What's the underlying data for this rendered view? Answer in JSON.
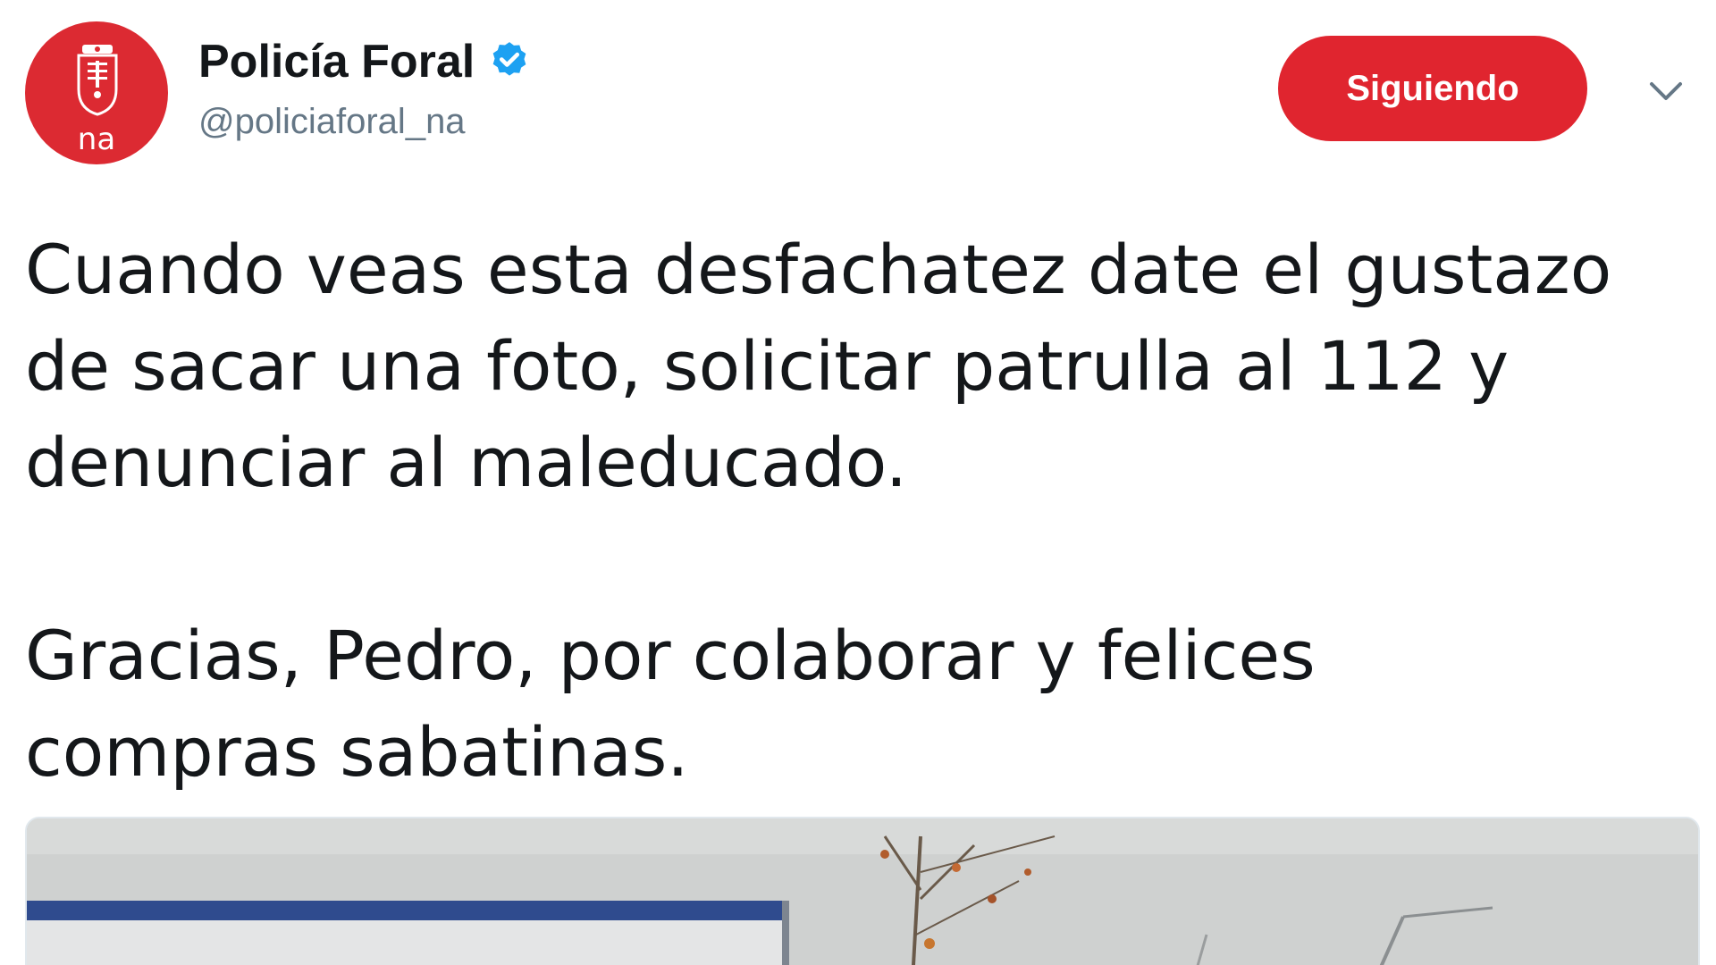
{
  "account": {
    "display_name": "Policía Foral",
    "handle": "@policiaforal_na",
    "verified": true,
    "avatar_text": "na",
    "avatar_color": "#dc2a32"
  },
  "follow_button": {
    "label": "Siguiendo",
    "color": "#e0252f"
  },
  "more_menu_icon": "chevron-down-icon",
  "tweet": {
    "text": "Cuando veas esta desfachatez date el gustazo\nde sacar una foto, solicitar patrulla al 112 y\ndenunciar al maleducado.\n\nGracias, Pedro, por colaborar y felices\ncompras sabatinas."
  },
  "media": {
    "type": "photo"
  },
  "colors": {
    "verified_badge": "#1da1f2",
    "text": "#14171a",
    "secondary_text": "#657786"
  }
}
